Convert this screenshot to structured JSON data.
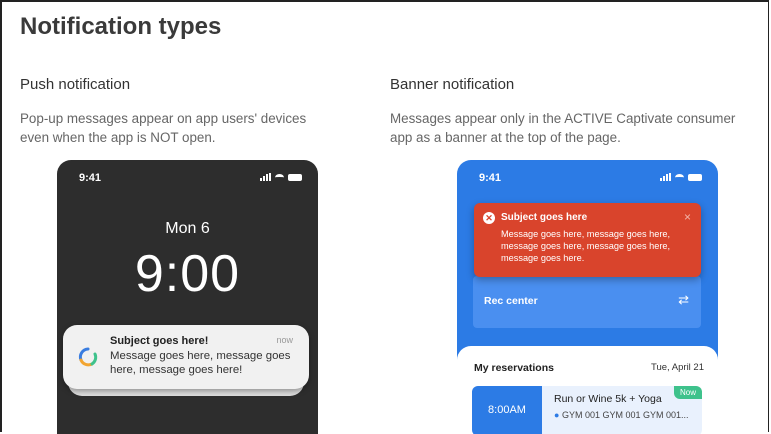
{
  "page": {
    "title": "Notification types"
  },
  "push": {
    "title": "Push notification",
    "description_line1": "Pop-up messages appear on app users' devices",
    "description_line2": "even when the app is NOT open.",
    "phone": {
      "time": "9:41",
      "date": "Mon 6",
      "clock": "9:00",
      "notification": {
        "subject": "Subject goes here!",
        "timestamp": "now",
        "message": "Message goes here, message goes here, message goes here!"
      }
    }
  },
  "banner": {
    "title": "Banner notification",
    "description_line1": "Messages appear only in the ACTIVE Captivate consumer",
    "description_line2": "app as a banner at the top of the page.",
    "phone": {
      "time": "9:41",
      "alert": {
        "subject": "Subject goes here",
        "message": "Message goes here, message goes here, message goes here, message goes here, message goes here.",
        "close_glyph": "×"
      },
      "rec_center": {
        "label": "Rec center",
        "icon_glyph": "⇄"
      },
      "reservations": {
        "title": "My reservations",
        "date": "Tue, April 21",
        "item": {
          "time": "8:00AM",
          "name": "Run or Wine 5k + Yoga",
          "location": "GYM 001 GYM 001 GYM 001...",
          "badge": "Now"
        }
      }
    }
  },
  "colors": {
    "dark_phone": "#2d2d2d",
    "blue_phone": "#2c7be5",
    "banner_red": "#d9442c",
    "badge_green": "#3ec28c"
  },
  "icons": [
    "signal-icon",
    "wifi-icon",
    "battery-icon",
    "app-logo-icon",
    "error-icon",
    "close-icon",
    "swap-icon",
    "location-pin-icon"
  ]
}
